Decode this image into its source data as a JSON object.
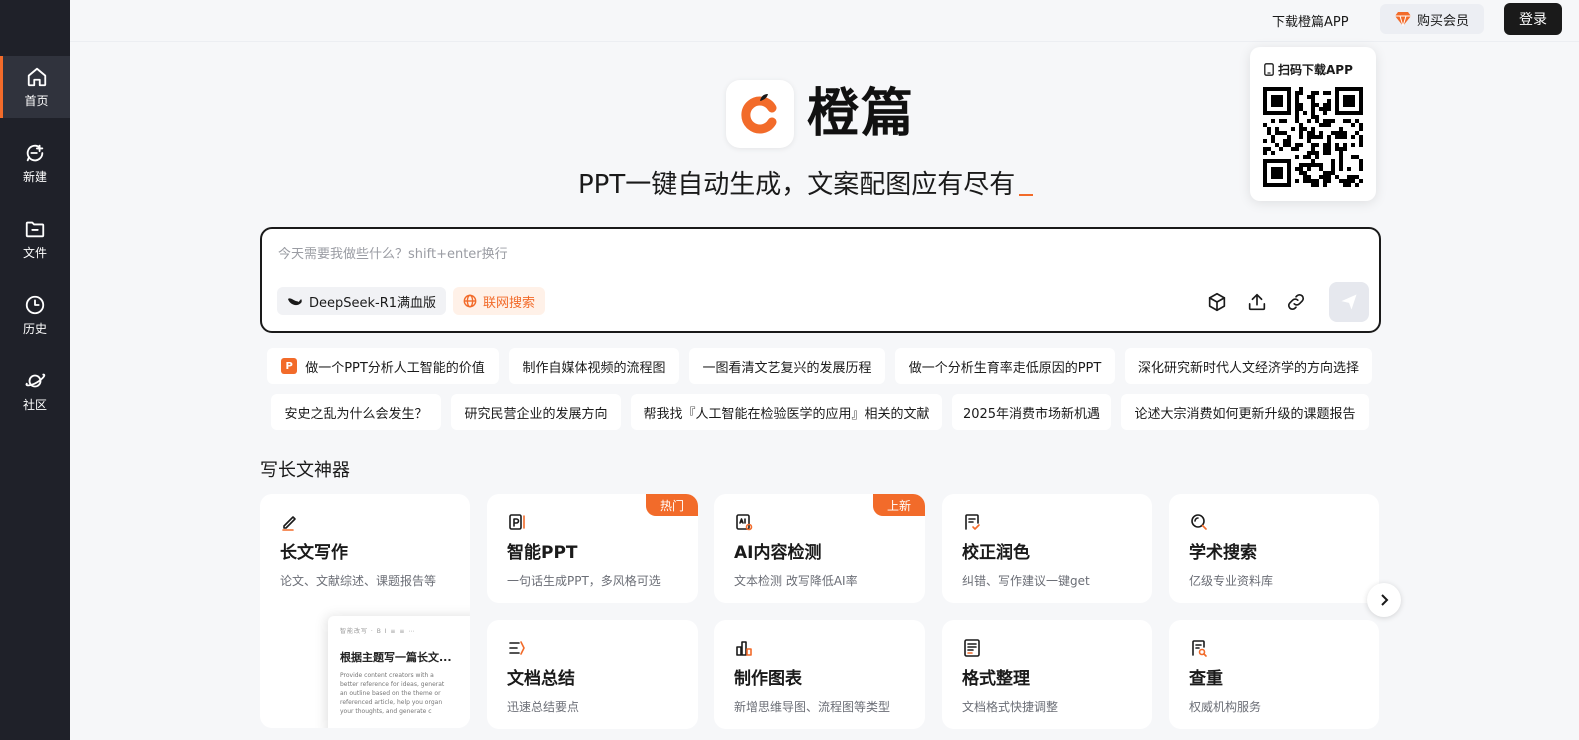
{
  "sidebar": {
    "items": [
      {
        "label": "首页",
        "icon": "home-icon",
        "active": true
      },
      {
        "label": "新建",
        "icon": "new-chat-icon"
      },
      {
        "label": "文件",
        "icon": "folder-icon"
      },
      {
        "label": "历史",
        "icon": "clock-icon"
      },
      {
        "label": "社区",
        "icon": "planet-icon"
      }
    ]
  },
  "topbar": {
    "download_app": "下载橙篇APP",
    "buy_vip": "购买会员",
    "login": "登录"
  },
  "qr": {
    "title": "扫码下载APP"
  },
  "brand": {
    "name": "橙篇",
    "slogan": "PPT一键自动生成，文案配图应有尽有",
    "accent": "#f26b2a"
  },
  "prompt": {
    "placeholder": "今天需要我做些什么？shift+enter换行",
    "model": "DeepSeek-R1满血版",
    "web_search": "联网搜索"
  },
  "suggestions": {
    "row1": [
      "做一个PPT分析人工智能的价值",
      "制作自媒体视频的流程图",
      "一图看清文艺复兴的发展历程",
      "做一个分析生育率走低原因的PPT",
      "深化研究新时代人文经济学的方向选择"
    ],
    "row2": [
      "安史之乱为什么会发生？",
      "研究民营企业的发展方向",
      "帮我找『人工智能在检验医学的应用』相关的文献",
      "2025年消费市场新机遇",
      "论述大宗消费如何更新升级的课题报告"
    ]
  },
  "section": {
    "title": "写长文神器"
  },
  "cards": [
    {
      "title": "长文写作",
      "desc": "论文、文献综述、课题报告等",
      "icon": "pen-icon"
    },
    {
      "title": "智能PPT",
      "desc": "一句话生成PPT，多风格可选",
      "icon": "ppt-icon",
      "badge": "热门"
    },
    {
      "title": "AI内容检测",
      "desc": "文本检测 改写降低AI率",
      "icon": "ai-detect-icon",
      "badge": "上新"
    },
    {
      "title": "校正润色",
      "desc": "纠错、写作建议一键get",
      "icon": "proofread-icon"
    },
    {
      "title": "学术搜索",
      "desc": "亿级专业资料库",
      "icon": "search-icon"
    },
    {
      "title": "文档总结",
      "desc": "迅速总结要点",
      "icon": "summary-icon"
    },
    {
      "title": "制作图表",
      "desc": "新增思维导图、流程图等类型",
      "icon": "chart-icon"
    },
    {
      "title": "格式整理",
      "desc": "文档格式快捷调整",
      "icon": "format-icon"
    },
    {
      "title": "查重",
      "desc": "权威机构服务",
      "icon": "plagiarism-icon"
    }
  ],
  "preview": {
    "toolbar": "智能改写 · B I ≡ ≡ ⋯",
    "title": "根据主题写一篇长文...",
    "lines": [
      "Provide content creators with a",
      "better reference for ideas, generat",
      "an outline based on the theme or",
      "referenced article, help you organ",
      "your thoughts, and generate c"
    ]
  }
}
